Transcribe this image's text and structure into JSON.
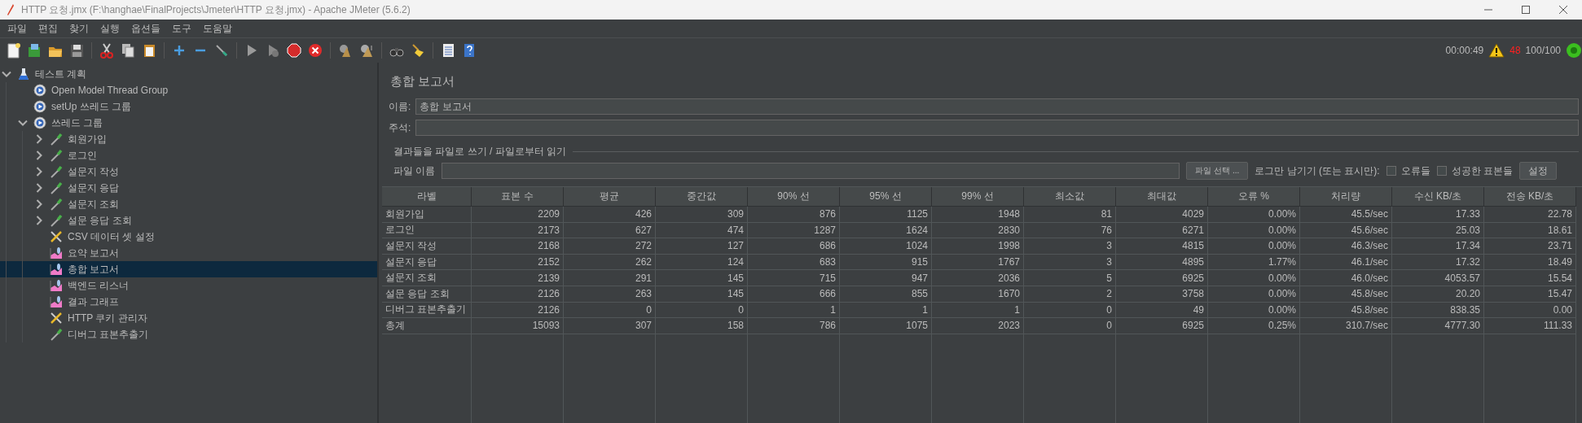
{
  "window": {
    "title": "HTTP 요청.jmx (F:\\hanghae\\FinalProjects\\Jmeter\\HTTP 요청.jmx) - Apache JMeter (5.6.2)"
  },
  "menu": [
    "파일",
    "편집",
    "찾기",
    "실행",
    "옵션들",
    "도구",
    "도움말"
  ],
  "status": {
    "elapsed": "00:00:49",
    "warnings": "48",
    "threads": "100/100"
  },
  "tree": [
    {
      "label": "테스트 계획",
      "kind": "plan",
      "expandable": true,
      "expanded": true,
      "selected": false,
      "children": [
        {
          "label": "Open Model Thread Group",
          "kind": "thread-group",
          "expandable": false,
          "selected": false
        },
        {
          "label": "setUp 쓰레드 그룹",
          "kind": "thread-group",
          "expandable": false,
          "selected": false
        },
        {
          "label": "쓰레드 그룹",
          "kind": "thread-group",
          "expandable": true,
          "expanded": true,
          "selected": false,
          "children": [
            {
              "label": "회원가입",
              "kind": "sampler",
              "expandable": true,
              "expanded": false,
              "selected": false
            },
            {
              "label": "로그인",
              "kind": "sampler",
              "expandable": true,
              "expanded": false,
              "selected": false
            },
            {
              "label": "설문지 작성",
              "kind": "sampler",
              "expandable": true,
              "expanded": false,
              "selected": false
            },
            {
              "label": "설문지 응답",
              "kind": "sampler",
              "expandable": true,
              "expanded": false,
              "selected": false
            },
            {
              "label": "설문지 조회",
              "kind": "sampler",
              "expandable": true,
              "expanded": false,
              "selected": false
            },
            {
              "label": "설문 응답 조회",
              "kind": "sampler",
              "expandable": true,
              "expanded": false,
              "selected": false
            },
            {
              "label": "CSV 데이터 셋 설정",
              "kind": "config",
              "expandable": false,
              "selected": false
            },
            {
              "label": "요약 보고서",
              "kind": "listener",
              "expandable": false,
              "selected": false
            },
            {
              "label": "총합 보고서",
              "kind": "listener",
              "expandable": false,
              "selected": true
            },
            {
              "label": "백엔드 리스너",
              "kind": "listener",
              "expandable": false,
              "selected": false
            },
            {
              "label": "결과 그래프",
              "kind": "listener",
              "expandable": false,
              "selected": false
            },
            {
              "label": "HTTP 쿠키 관리자",
              "kind": "config",
              "expandable": false,
              "selected": false
            },
            {
              "label": "디버그 표본추출기",
              "kind": "sampler",
              "expandable": false,
              "selected": false
            }
          ]
        }
      ]
    }
  ],
  "panel": {
    "title": "총합 보고서",
    "name_label": "이름:",
    "name_value": "총합 보고서",
    "comment_label": "주석:",
    "file_group": {
      "title": "결과들을 파일로 쓰기 / 파일로부터 읽기",
      "file_label": "파일 이름",
      "browse_button": "파일 선택 ...",
      "log_label": "로그만 남기기 (또는 표시만):",
      "checkboxes": [
        {
          "label": "오류들",
          "checked": false
        },
        {
          "label": "성공한 표본들",
          "checked": false
        }
      ],
      "settings_button": "설정"
    }
  },
  "table": {
    "columns": [
      "라벨",
      "표본 수",
      "평균",
      "중간값",
      "90% 선",
      "95% 선",
      "99% 선",
      "최소값",
      "최대값",
      "오류 %",
      "처리량",
      "수신 KB/초",
      "전송 KB/초"
    ],
    "rows": [
      [
        "회원가입",
        "2209",
        "426",
        "309",
        "876",
        "1125",
        "1948",
        "81",
        "4029",
        "0.00%",
        "45.5/sec",
        "17.33",
        "22.78"
      ],
      [
        "로그인",
        "2173",
        "627",
        "474",
        "1287",
        "1624",
        "2830",
        "76",
        "6271",
        "0.00%",
        "45.6/sec",
        "25.03",
        "18.61"
      ],
      [
        "설문지 작성",
        "2168",
        "272",
        "127",
        "686",
        "1024",
        "1998",
        "3",
        "4815",
        "0.00%",
        "46.3/sec",
        "17.34",
        "23.71"
      ],
      [
        "설문지 응답",
        "2152",
        "262",
        "124",
        "683",
        "915",
        "1767",
        "3",
        "4895",
        "1.77%",
        "46.1/sec",
        "17.32",
        "18.49"
      ],
      [
        "설문지 조회",
        "2139",
        "291",
        "145",
        "715",
        "947",
        "2036",
        "5",
        "6925",
        "0.00%",
        "46.0/sec",
        "4053.57",
        "15.54"
      ],
      [
        "설문 응답 조회",
        "2126",
        "263",
        "145",
        "666",
        "855",
        "1670",
        "2",
        "3758",
        "0.00%",
        "45.8/sec",
        "20.20",
        "15.47"
      ],
      [
        "디버그 표본추출기",
        "2126",
        "0",
        "0",
        "1",
        "1",
        "1",
        "0",
        "49",
        "0.00%",
        "45.8/sec",
        "838.35",
        "0.00"
      ],
      [
        "총계",
        "15093",
        "307",
        "158",
        "786",
        "1075",
        "2023",
        "0",
        "6925",
        "0.25%",
        "310.7/sec",
        "4777.30",
        "111.33"
      ]
    ]
  }
}
